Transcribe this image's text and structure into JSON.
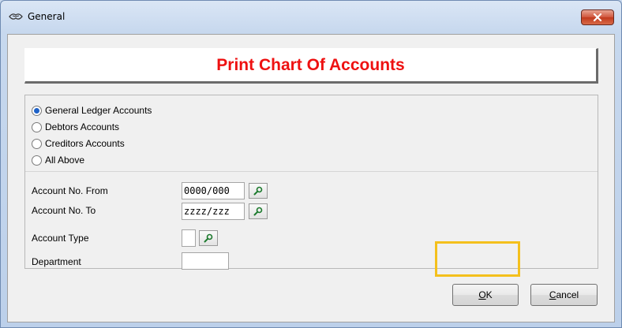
{
  "window": {
    "title": "General",
    "close_icon": "close-icon"
  },
  "header": {
    "title": "Print Chart Of Accounts",
    "title_color": "#ee1111"
  },
  "account_options": [
    {
      "label": "General Ledger Accounts",
      "checked": true
    },
    {
      "label": "Debtors Accounts",
      "checked": false
    },
    {
      "label": "Creditors Accounts",
      "checked": false
    },
    {
      "label": "All Above",
      "checked": false
    }
  ],
  "fields": {
    "account_from": {
      "label": "Account No. From",
      "value": "0000/000"
    },
    "account_to": {
      "label": "Account No. To",
      "value": "zzzz/zzz"
    },
    "account_type": {
      "label": "Account Type",
      "value": ""
    },
    "department": {
      "label": "Department",
      "value": ""
    }
  },
  "buttons": {
    "ok": {
      "mnemonic": "O",
      "rest": "K"
    },
    "cancel": {
      "mnemonic": "C",
      "rest": "ancel"
    }
  },
  "highlight_color": "#f4c01c"
}
